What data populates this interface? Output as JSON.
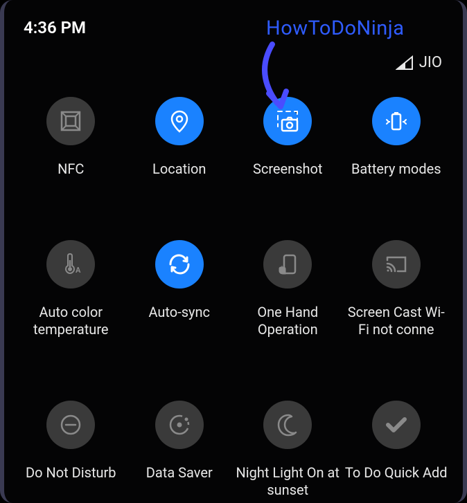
{
  "status": {
    "time": "4:36 PM",
    "carrier": "JIO"
  },
  "watermark": "HowToDoNinja",
  "tiles": [
    {
      "label": "NFC",
      "state": "off"
    },
    {
      "label": "Location",
      "state": "on"
    },
    {
      "label": "Screenshot",
      "state": "on"
    },
    {
      "label": "Battery modes",
      "state": "on"
    },
    {
      "label": "Auto color temperature",
      "state": "off"
    },
    {
      "label": "Auto-sync",
      "state": "on"
    },
    {
      "label": "One Hand Operation",
      "state": "off"
    },
    {
      "label": "Screen Cast Wi-Fi not conne",
      "state": "off"
    },
    {
      "label": "Do Not Disturb",
      "state": "off"
    },
    {
      "label": "Data Saver",
      "state": "off"
    },
    {
      "label": "Night Light On at sunset",
      "state": "off"
    },
    {
      "label": "To Do Quick Add",
      "state": "off"
    }
  ],
  "colors": {
    "accent": "#1a82ff",
    "off_tile": "#3a3a3a",
    "watermark": "#2f5cff"
  }
}
